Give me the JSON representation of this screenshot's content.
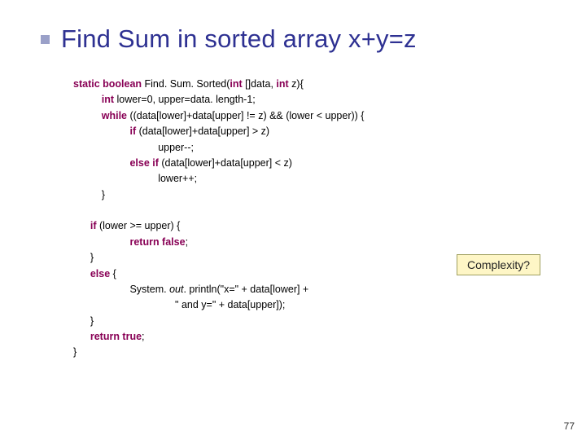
{
  "title": "Find Sum in sorted array x+y=z",
  "code": {
    "l1a": "static boolean",
    "l1b": " Find. Sum. Sorted(",
    "l1c": "int",
    "l1d": " []data, ",
    "l1e": "int",
    "l1f": " z){",
    "l2a": "int",
    "l2b": " lower=0, upper=data. length-1;",
    "l3a": "while",
    "l3b": " ((data[lower]+data[upper] != z) && (lower < upper)) {",
    "l4a": "if",
    "l4b": " (data[lower]+data[upper] > z)",
    "l5": "upper--;",
    "l6a": "else if",
    "l6b": " (data[lower]+data[upper] < z)",
    "l7": "lower++;",
    "l8": "}",
    "l10a": "if",
    "l10b": " (lower >= upper) {",
    "l11a": "return false",
    "l11b": ";",
    "l12": "}",
    "l13a": "else",
    "l13b": " {",
    "l14a": "System. ",
    "l14b": "out",
    "l14c": ". println(\"x=\" + data[lower] +",
    "l15": "\" and y=\" + data[upper]);",
    "l16": "}",
    "l17a": "return true",
    "l17b": ";",
    "l18": "}"
  },
  "complexity_label": "Complexity?",
  "page_number": "77"
}
